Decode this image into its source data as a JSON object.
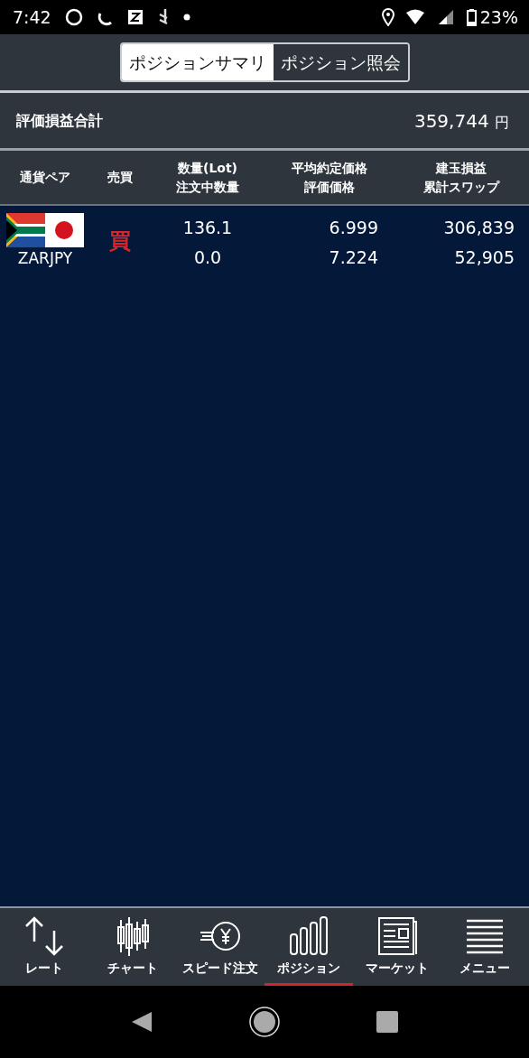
{
  "status_bar": {
    "time": "7:42",
    "battery": "23%"
  },
  "tabs": [
    {
      "label": "ポジションサマリ",
      "selected": true
    },
    {
      "label": "ポジション照会",
      "selected": false
    }
  ],
  "summary": {
    "label": "評価損益合計",
    "value": "359,744",
    "unit": "円"
  },
  "table": {
    "columns": [
      [
        "通貨ペア"
      ],
      [
        "売買"
      ],
      [
        "数量(Lot)",
        "注文中数量"
      ],
      [
        "平均約定価格",
        "評価価格"
      ],
      [
        "建玉損益",
        "累計スワップ"
      ]
    ],
    "rows": [
      {
        "pair": "ZARJPY",
        "side": "買",
        "kind": "buy",
        "quantity": "136.1",
        "pending_quantity": "0.0",
        "avg_price": "6.999",
        "valuation_price": "7.224",
        "position_pl": "306,839",
        "swap": "52,905"
      }
    ]
  },
  "bottom_nav": [
    {
      "label": "レート",
      "selected": false
    },
    {
      "label": "チャート",
      "selected": false
    },
    {
      "label": "スピード注文",
      "selected": false
    },
    {
      "label": "ポジション",
      "selected": true
    },
    {
      "label": "マーケット",
      "selected": false
    },
    {
      "label": "メニュー",
      "selected": false
    }
  ]
}
